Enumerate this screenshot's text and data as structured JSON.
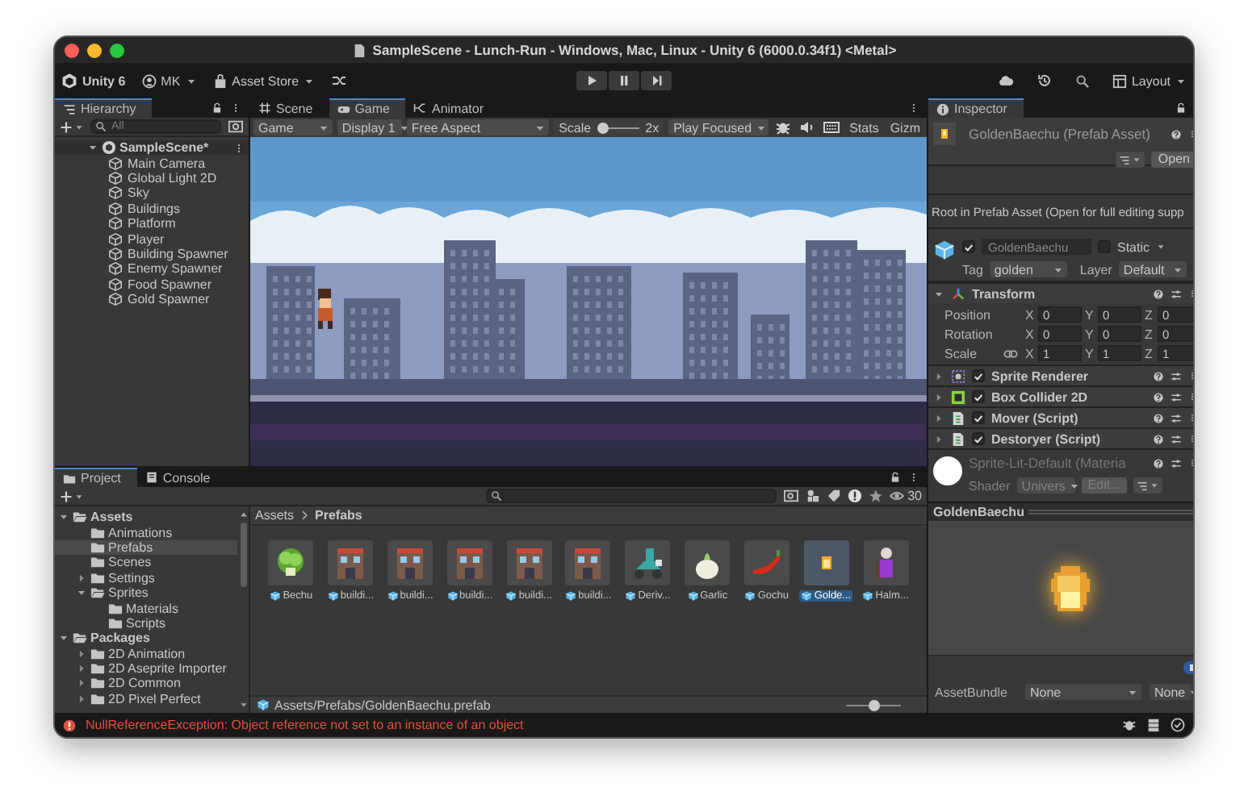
{
  "window": {
    "title": "SampleScene - Lunch-Run - Windows, Mac, Linux - Unity 6 (6000.0.34f1) <Metal>"
  },
  "toolbar": {
    "account": "Unity 6",
    "user": "MK",
    "asset_store": "Asset Store",
    "layout": "Layout"
  },
  "hierarchy": {
    "tab": "Hierarchy",
    "search_placeholder": "All",
    "scene": {
      "name": "SampleScene*",
      "expanded": true,
      "children": [
        {
          "name": "Main Camera"
        },
        {
          "name": "Global Light 2D"
        },
        {
          "name": "Sky"
        },
        {
          "name": "Buildings"
        },
        {
          "name": "Platform"
        },
        {
          "name": "Player"
        },
        {
          "name": "Building Spawner"
        },
        {
          "name": "Enemy Spawner"
        },
        {
          "name": "Food Spawner"
        },
        {
          "name": "Gold Spawner"
        }
      ]
    }
  },
  "game": {
    "tabs": [
      {
        "label": "Scene",
        "kind": "scene",
        "selected": false
      },
      {
        "label": "Game",
        "kind": "game",
        "selected": true
      },
      {
        "label": "Animator",
        "kind": "animator",
        "selected": false
      }
    ],
    "view_mode": "Game",
    "display": "Display 1",
    "aspect": "Free Aspect",
    "scale_label": "Scale",
    "scale": {
      "level": 0.1
    },
    "scale_value": "2x",
    "play_mode": "Play Focused",
    "stats": "Stats",
    "gizmos": "Gizm"
  },
  "project": {
    "tabs": [
      {
        "label": "Project",
        "kind": "project",
        "selected": true
      },
      {
        "label": "Console",
        "kind": "console",
        "selected": false
      }
    ],
    "tree": [
      {
        "name": "Assets",
        "expanded": true,
        "selected": false,
        "children": [
          {
            "name": "Animations",
            "selected": false
          },
          {
            "name": "Prefabs",
            "selected": true
          },
          {
            "name": "Scenes",
            "selected": false
          },
          {
            "name": "Settings",
            "expanded": false,
            "selected": false
          },
          {
            "name": "Sprites",
            "expanded": true,
            "selected": false,
            "children": [
              {
                "name": "Materials",
                "selected": false
              },
              {
                "name": "Scripts",
                "selected": false
              }
            ]
          }
        ]
      },
      {
        "name": "Packages",
        "expanded": true,
        "selected": false,
        "children": [
          {
            "name": "2D Animation",
            "expanded": false,
            "selected": false
          },
          {
            "name": "2D Aseprite Importer",
            "expanded": false,
            "selected": false
          },
          {
            "name": "2D Common",
            "expanded": false,
            "selected": false
          },
          {
            "name": "2D Pixel Perfect",
            "expanded": false,
            "selected": false
          }
        ]
      }
    ],
    "breadcrumb": [
      "Assets",
      "Prefabs"
    ],
    "assets": [
      {
        "label": "Bechu",
        "kind": "cabbage",
        "selected": false
      },
      {
        "label": "buildi...",
        "kind": "building",
        "selected": false
      },
      {
        "label": "buildi...",
        "kind": "building",
        "selected": false
      },
      {
        "label": "buildi...",
        "kind": "building",
        "selected": false
      },
      {
        "label": "buildi...",
        "kind": "building",
        "selected": false
      },
      {
        "label": "buildi...",
        "kind": "building",
        "selected": false
      },
      {
        "label": "Deriv...",
        "kind": "rider",
        "selected": false
      },
      {
        "label": "Garlic",
        "kind": "garlic",
        "selected": false
      },
      {
        "label": "Gochu",
        "kind": "pepper",
        "selected": false
      },
      {
        "label": "Golde...",
        "kind": "golden",
        "selected": true
      },
      {
        "label": "Halm...",
        "kind": "grandma",
        "selected": false
      }
    ],
    "hidden_count": "30",
    "path": "Assets/Prefabs/GoldenBaechu.prefab",
    "zoom": {
      "level": 0.5
    }
  },
  "inspector": {
    "tab": "Inspector",
    "title": "GoldenBaechu (Prefab Asset)",
    "open_button": "Open",
    "note": "Root in Prefab Asset (Open for full editing supp",
    "object": {
      "active": true,
      "name": "GoldenBaechu",
      "static": {
        "label": "Static",
        "checked": false
      },
      "tag_label": "Tag",
      "tag": "golden",
      "layer_label": "Layer",
      "layer": "Default"
    },
    "transform": {
      "name": "Transform",
      "expanded": true,
      "rows": [
        {
          "label": "Position",
          "linked": false,
          "values": [
            {
              "axis": "X",
              "value": "0"
            },
            {
              "axis": "Y",
              "value": "0"
            },
            {
              "axis": "Z",
              "value": "0"
            }
          ]
        },
        {
          "label": "Rotation",
          "linked": false,
          "values": [
            {
              "axis": "X",
              "value": "0"
            },
            {
              "axis": "Y",
              "value": "0"
            },
            {
              "axis": "Z",
              "value": "0"
            }
          ]
        },
        {
          "label": "Scale",
          "linked": true,
          "values": [
            {
              "axis": "X",
              "value": "1"
            },
            {
              "axis": "Y",
              "value": "1"
            },
            {
              "axis": "Z",
              "value": "1"
            }
          ]
        }
      ]
    },
    "components": [
      {
        "name": "Sprite Renderer",
        "kind": "sprite",
        "enabled": true,
        "expanded": false
      },
      {
        "name": "Box Collider 2D",
        "kind": "collider",
        "enabled": true,
        "expanded": false
      },
      {
        "name": "Mover (Script)",
        "kind": "script",
        "enabled": true,
        "expanded": false
      },
      {
        "name": "Destoryer (Script)",
        "kind": "script",
        "enabled": true,
        "expanded": false
      }
    ],
    "material": {
      "name": "Sprite-Lit-Default (Materia",
      "shader_label": "Shader",
      "shader": "Univers",
      "edit_button": "Edit..."
    },
    "preview_title": "GoldenBaechu",
    "asset_bundle": {
      "label": "AssetBundle",
      "name": "None",
      "variant": "None"
    }
  },
  "status_bar": {
    "message": "NullReferenceException: Object reference not set to an instance of an object"
  }
}
